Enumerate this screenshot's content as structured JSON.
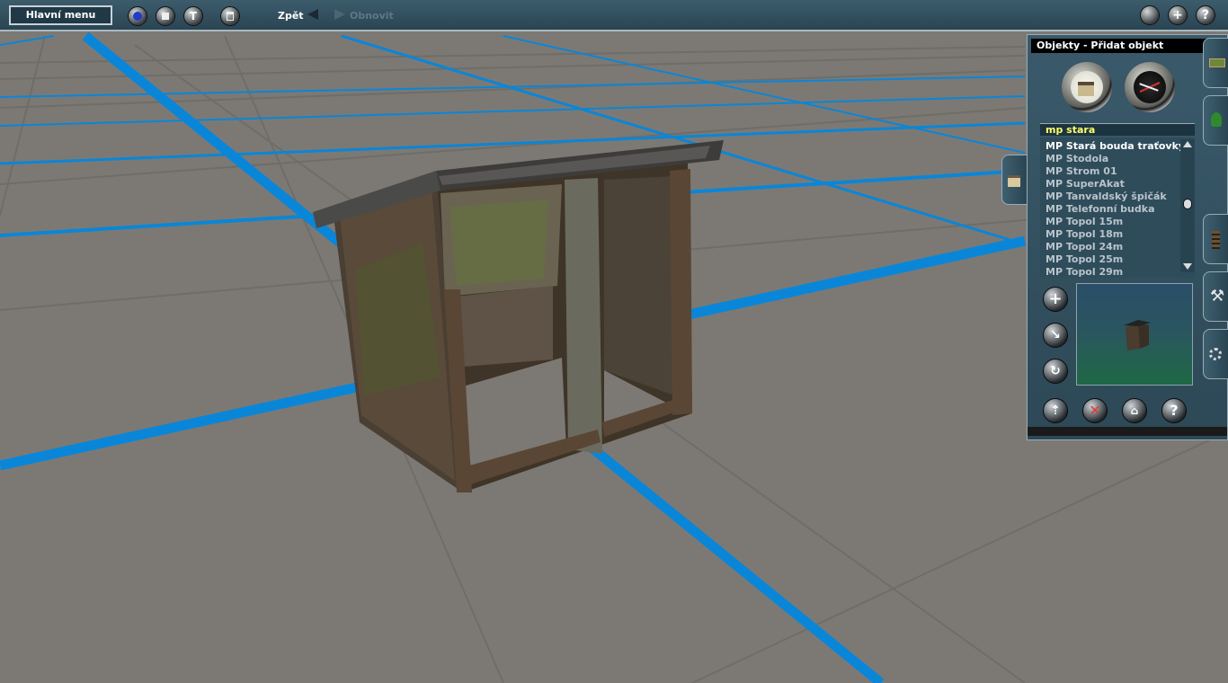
{
  "toolbar": {
    "main_menu_label": "Hlavní menu",
    "undo_label": "Zpět",
    "redo_label": "Obnovit",
    "left_icons": [
      "globe-icon",
      "stop-icon",
      "hammer-icon",
      "trash-icon"
    ],
    "right_icons": [
      "sphere-icon",
      "plus-icon",
      "help-icon"
    ]
  },
  "panel": {
    "title": "Objekty - Přidat objekt",
    "mode_buttons": [
      "house-icon",
      "gauge-icon"
    ],
    "filter_text": "mp stara",
    "items": [
      "MP Stará bouda traťovky",
      "MP Stodola",
      "MP Strom 01",
      "MP SuperAkat",
      "MP Tanvaldský špičák",
      "MP Telefonní budka",
      "MP Topol 15m",
      "MP Topol 18m",
      "MP Topol 24m",
      "MP Topol 25m",
      "MP Topol 29m"
    ],
    "selected_index": 0,
    "side_tools": [
      "add-icon",
      "move-icon",
      "rotate-icon"
    ],
    "bottom_tools": [
      "pick-icon",
      "delete-icon",
      "replace-icon",
      "help-icon"
    ]
  },
  "tabs": [
    "track-tab-icon",
    "tree-tab-icon",
    "rail-tab-icon",
    "wrench-tab-icon",
    "settings-tab-icon"
  ],
  "colors": {
    "grid_blue": "#0a86d8",
    "ground": "#7c7974",
    "panel_bg": "#2d4856",
    "filter_text": "#ffff66"
  }
}
